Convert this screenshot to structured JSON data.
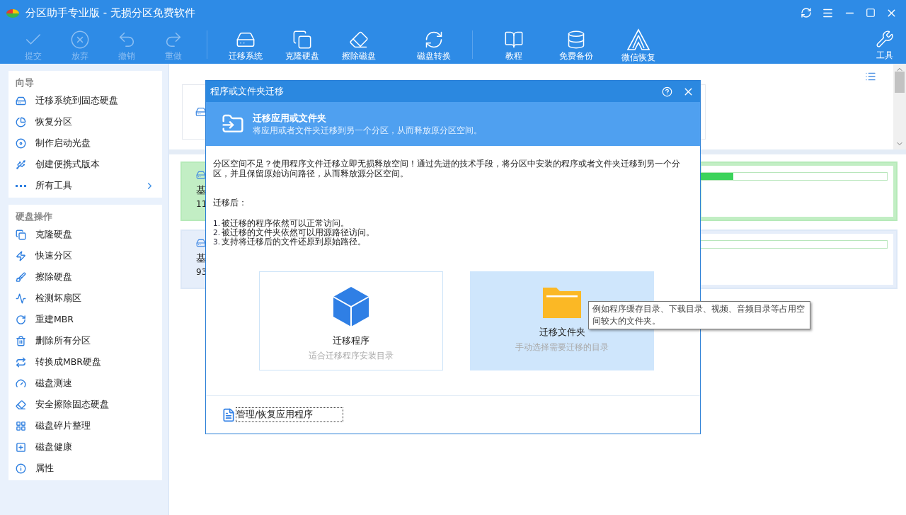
{
  "window": {
    "title": "分区助手专业版 - 无损分区免费软件"
  },
  "toolbar": [
    {
      "kind": "button",
      "label": "提交",
      "disabled": true
    },
    {
      "kind": "button",
      "label": "放弃",
      "disabled": true
    },
    {
      "kind": "button",
      "label": "撤销",
      "disabled": true
    },
    {
      "kind": "button",
      "label": "重做",
      "disabled": true
    },
    {
      "kind": "divider"
    },
    {
      "kind": "button",
      "label": "迁移系统",
      "disabled": false
    },
    {
      "kind": "button",
      "label": "克隆硬盘",
      "disabled": false
    },
    {
      "kind": "button",
      "label": "擦除磁盘",
      "disabled": false
    },
    {
      "kind": "button",
      "label": "磁盘转换",
      "disabled": false
    },
    {
      "kind": "divider"
    },
    {
      "kind": "button",
      "label": "教程",
      "disabled": false
    },
    {
      "kind": "button",
      "label": "免费备份",
      "disabled": false
    },
    {
      "kind": "button",
      "label": "微信恢复",
      "disabled": false
    }
  ],
  "tools_button": {
    "label": "工具"
  },
  "sidebar": [
    {
      "title": "向导",
      "items": [
        {
          "label": "迁移系统到固态硬盘",
          "has_submenu": false
        },
        {
          "label": "恢复分区",
          "has_submenu": false
        },
        {
          "label": "制作启动光盘",
          "has_submenu": false
        },
        {
          "label": "创建便携式版本",
          "has_submenu": false
        },
        {
          "label": "所有工具",
          "has_submenu": true
        }
      ]
    },
    {
      "title": "硬盘操作",
      "items": [
        {
          "label": "克隆硬盘",
          "has_submenu": false
        },
        {
          "label": "快速分区",
          "has_submenu": false
        },
        {
          "label": "擦除硬盘",
          "has_submenu": false
        },
        {
          "label": "检测坏扇区",
          "has_submenu": false
        },
        {
          "label": "重建MBR",
          "has_submenu": false
        },
        {
          "label": "删除所有分区",
          "has_submenu": false
        },
        {
          "label": "转换成MBR硬盘",
          "has_submenu": false
        },
        {
          "label": "磁盘测速",
          "has_submenu": false
        },
        {
          "label": "安全擦除固态硬盘",
          "has_submenu": false
        },
        {
          "label": "磁盘碎片整理",
          "has_submenu": false
        },
        {
          "label": "磁盘健康",
          "has_submenu": false
        },
        {
          "label": "属性",
          "has_submenu": false
        }
      ]
    }
  ],
  "disks": [
    {
      "name": "基",
      "size": "11",
      "selected": true,
      "level": 0.77
    },
    {
      "name": "基",
      "size": "93",
      "selected": false
    }
  ],
  "dialog": {
    "title": "程序或文件夹迁移",
    "header_title": "迁移应用或文件夹",
    "header_subtitle": "将应用或者文件夹迁移到另一个分区，从而释放原分区空间。",
    "intro": "分区空间不足？使用程序文件迁移立即无损释放空间！通过先进的技术手段，将分区中安装的程序或者文件夹迁移到另一个分区，并且保留原始访问路径，从而释放源分区空间。",
    "after_heading": "迁移后：",
    "points": [
      {
        "number": "1.",
        "text": "被迁移的程序依然可以正常访问。"
      },
      {
        "number": "2.",
        "text": "被迁移的文件夹依然可以用源路径访问。"
      },
      {
        "number": "3.",
        "text": "支持将迁移后的文件还原到原始路径。"
      }
    ],
    "options": [
      {
        "kind": "program",
        "title": "迁移程序",
        "subtitle": "适合迁移程序安装目录",
        "selected": false
      },
      {
        "kind": "folder",
        "title": "迁移文件夹",
        "subtitle": "手动选择需要迁移的目录",
        "selected": true
      }
    ],
    "footer_link": {
      "label": "管理/恢复应用程序",
      "focused": true
    }
  },
  "tooltip": "例如程序缓存目录、下载目录、视频、音频目录等占用空间较大的文件夹。"
}
